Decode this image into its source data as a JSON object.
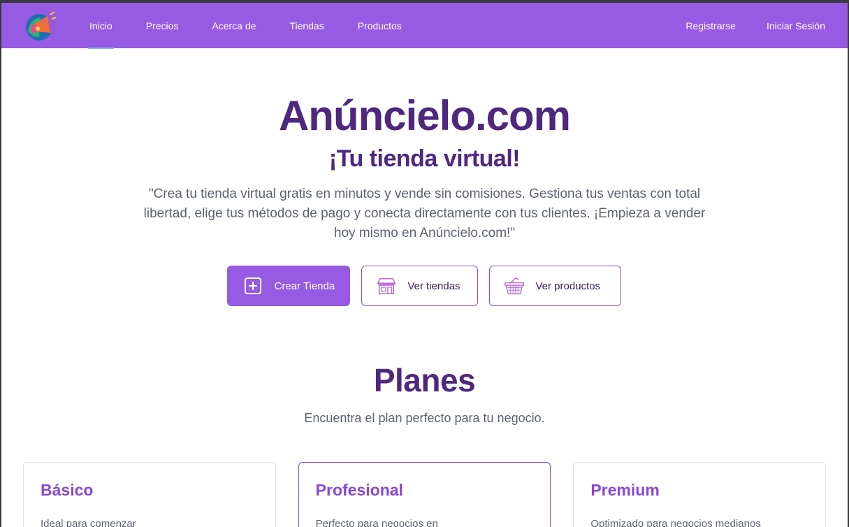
{
  "nav": {
    "links": [
      {
        "label": "Inicio"
      },
      {
        "label": "Precios"
      },
      {
        "label": "Acerca de"
      },
      {
        "label": "Tiendas"
      },
      {
        "label": "Productos"
      }
    ],
    "register": "Registrarse",
    "login": "Iniciar Sesión"
  },
  "hero": {
    "brand": "Anúncielo.com",
    "tagline": "¡Tu tienda virtual!",
    "description": "\"Crea tu tienda virtual gratis en minutos y vende sin comisiones. Gestiona tus ventas con total libertad, elige tus métodos de pago y conecta directamente con tus clientes. ¡Empieza a vender hoy mismo en Anúncielo.com!\"",
    "buttons": {
      "create": "Crear Tienda",
      "stores": "Ver tiendas",
      "products": "Ver productos"
    }
  },
  "plans": {
    "title": "Planes",
    "subtitle": "Encuentra el plan perfecto para tu negocio.",
    "cards": [
      {
        "title": "Básico",
        "desc": "Ideal para comenzar"
      },
      {
        "title": "Profesional",
        "desc": "Perfecto para negocios en"
      },
      {
        "title": "Premium",
        "desc": "Optimizado para negocios medianos"
      }
    ]
  },
  "colors": {
    "nav": "#975ae2",
    "heading": "#4e277f",
    "accent": "#8a47d3"
  }
}
